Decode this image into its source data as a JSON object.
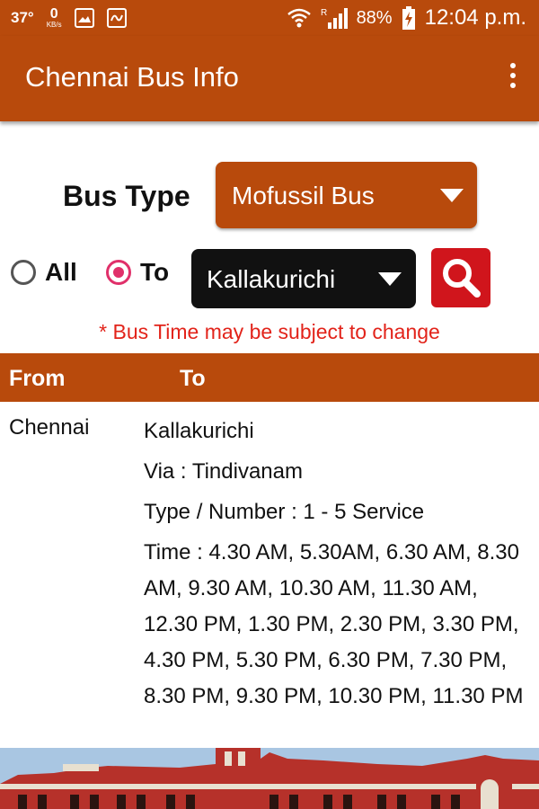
{
  "status_bar": {
    "temperature": "37°",
    "network_speed": "0",
    "network_unit": "KB/s",
    "battery": "88%",
    "time": "12:04 p.m.",
    "icons": [
      "image-icon",
      "activity-icon",
      "wifi-icon",
      "signal-icon",
      "battery-charging-icon"
    ]
  },
  "app_bar": {
    "title": "Chennai Bus Info",
    "menu_icon": "more-vert-icon"
  },
  "form": {
    "bus_type_label": "Bus Type",
    "bus_type_value": "Mofussil Bus",
    "radio_all_label": "All",
    "radio_to_label": "To",
    "radio_selected": "To",
    "destination_value": "Kallakurichi",
    "search_icon": "search-icon"
  },
  "note": "* Bus Time may be subject to change",
  "table": {
    "headers": {
      "from": "From",
      "to": "To"
    },
    "rows": [
      {
        "from": "Chennai",
        "to": "Kallakurichi",
        "via": "Via : Tindivanam",
        "type_number": "Type / Number :  1 - 5  Service",
        "time": "Time : 4.30 AM,  5.30AM,  6.30 AM,  8.30 AM,  9.30 AM,  10.30 AM,  11.30 AM,  12.30 PM,  1.30 PM,  2.30 PM,  3.30 PM,  4.30 PM,  5.30 PM,  6.30 PM,  7.30 PM,  8.30 PM,  9.30 PM,  10.30 PM,  11.30 PM"
      }
    ]
  },
  "colors": {
    "brand": "#b84a0c",
    "radio_accent": "#e0306a",
    "note_red": "#e2231a",
    "search_red": "#d0151c"
  }
}
